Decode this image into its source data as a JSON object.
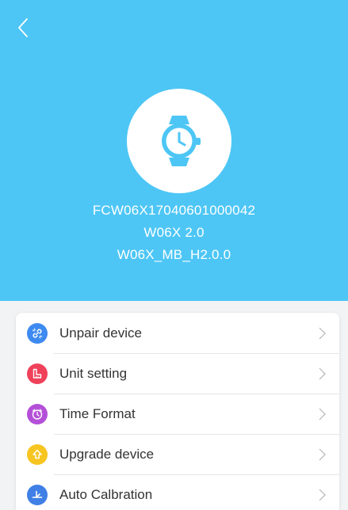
{
  "colors": {
    "header_bg": "#4dc6f5",
    "accent_blue": "#3d8af0",
    "accent_red": "#f0415a",
    "accent_purple": "#b44fd8",
    "accent_yellow": "#f7c521",
    "accent_blue2": "#3f7fe6"
  },
  "header": {
    "back_icon": "chevron-left-icon",
    "device_icon": "smartwatch-icon",
    "serial": "FCW06X17040601000042",
    "model": "W06X 2.0",
    "firmware": "W06X_MB_H2.0.0"
  },
  "menu": {
    "items": [
      {
        "label": "Unpair device",
        "icon": "unlink-icon",
        "color": "#3d8af0"
      },
      {
        "label": "Unit setting",
        "icon": "ruler-icon",
        "color": "#f0415a"
      },
      {
        "label": "Time Format",
        "icon": "clock-icon",
        "color": "#b44fd8"
      },
      {
        "label": "Upgrade device",
        "icon": "upgrade-arrow-icon",
        "color": "#f7c521"
      },
      {
        "label": "Auto Calbration",
        "icon": "calibration-icon",
        "color": "#3f7fe6"
      }
    ]
  }
}
